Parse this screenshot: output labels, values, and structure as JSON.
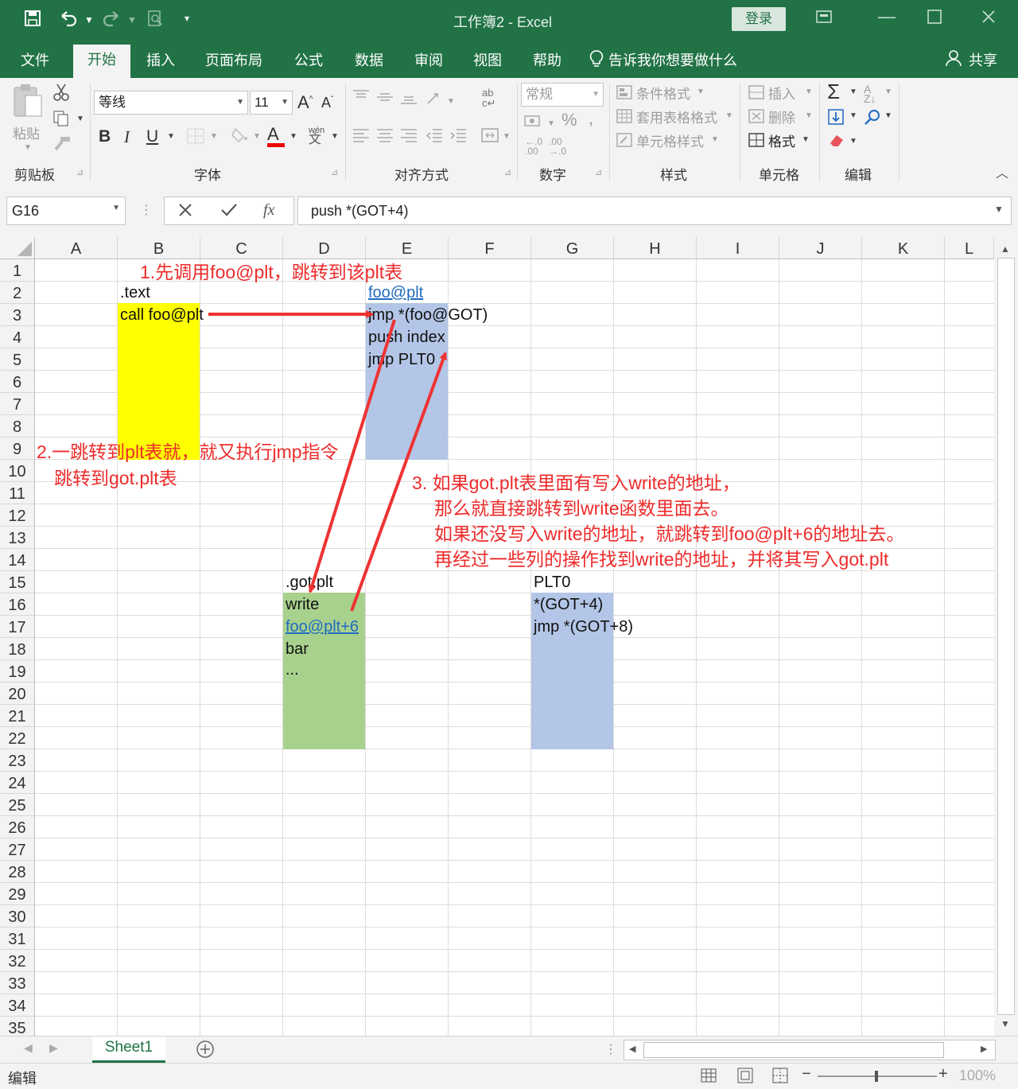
{
  "window": {
    "title": "工作簿2 - Excel",
    "login": "登录",
    "share": "共享"
  },
  "menu": {
    "tabs": [
      "文件",
      "开始",
      "插入",
      "页面布局",
      "公式",
      "数据",
      "审阅",
      "视图",
      "帮助"
    ],
    "tell_me": "告诉我你想要做什么"
  },
  "ribbon": {
    "clipboard": {
      "paste": "粘贴",
      "label": "剪贴板"
    },
    "font": {
      "name": "等线",
      "size": "11",
      "label": "字体",
      "bold": "B",
      "italic": "I",
      "underline": "U",
      "phonetic_top": "wén",
      "phonetic_bottom": "文"
    },
    "alignment": {
      "label": "对齐方式"
    },
    "number": {
      "format": "常规",
      "label": "数字",
      "percent": "%",
      "comma": ","
    },
    "styles": {
      "conditional": "条件格式",
      "table": "套用表格格式",
      "cell": "单元格样式",
      "label": "样式"
    },
    "cells": {
      "insert": "插入",
      "delete": "删除",
      "format": "格式",
      "label": "单元格"
    },
    "editing": {
      "label": "编辑"
    }
  },
  "formula_bar": {
    "name_box": "G16",
    "fx": "fx",
    "formula": "push *(GOT+4)"
  },
  "grid": {
    "columns": [
      "A",
      "B",
      "C",
      "D",
      "E",
      "F",
      "G",
      "H",
      "I",
      "J",
      "K",
      "L"
    ],
    "rows": [
      "1",
      "2",
      "3",
      "4",
      "5",
      "6",
      "7",
      "8",
      "9",
      "10",
      "11",
      "12",
      "13",
      "14",
      "15",
      "16",
      "17",
      "18",
      "19",
      "20",
      "21",
      "22",
      "23",
      "24",
      "25",
      "26",
      "27",
      "28",
      "29",
      "30",
      "31",
      "32",
      "33",
      "34",
      "35"
    ],
    "cells": {
      "B2": ".text",
      "B3": "call foo@plt",
      "E2": "foo@plt",
      "E3": "jmp *(foo@GOT)",
      "E4": "push index",
      "E5": "jmp PLT0",
      "D15": ".got.plt",
      "D16": "write",
      "D17": "foo@plt+6",
      "D18": "bar",
      "D19": "...",
      "G15": "PLT0",
      "G16": "*(GOT+4)",
      "G17": "jmp *(GOT+8)"
    },
    "fills": {
      "yellow": "#ffff00",
      "blue": "#b4c6e7",
      "green": "#a9d18e"
    },
    "annotations": {
      "note1": "1.先调用foo@plt，跳转到该plt表",
      "note2_line1": "2.一跳转到plt表就，就又执行jmp指令",
      "note2_line2": "跳转到got.plt表",
      "note3_line1": "3. 如果got.plt表里面有写入write的地址，",
      "note3_line2": "那么就直接跳转到write函数里面去。",
      "note3_line3": "如果还没写入write的地址，就跳转到foo@plt+6的地址去。",
      "note3_line4": "再经过一些列的操作找到write的地址，并将其写入got.plt"
    },
    "arrow_color": "#ee3333"
  },
  "sheets": {
    "tabs": [
      "Sheet1"
    ]
  },
  "status": {
    "mode": "编辑",
    "zoom": "100%"
  },
  "colors": {
    "accent": "#217346"
  }
}
